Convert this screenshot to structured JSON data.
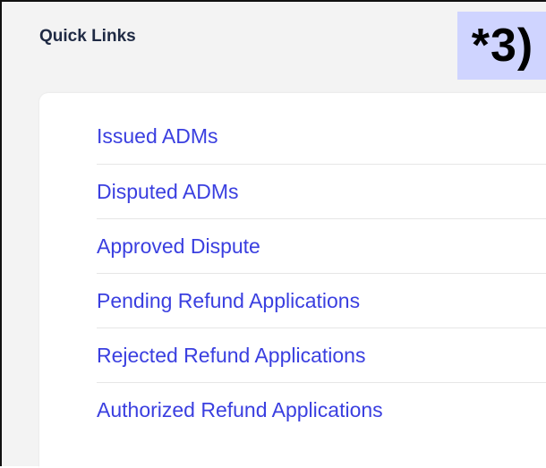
{
  "panel": {
    "title": "Quick Links"
  },
  "annotation": {
    "label": "*3)",
    "background_color": "#cfd4ff"
  },
  "quick_links": {
    "link_color": "#3a3fe0",
    "items": [
      {
        "label": "Issued ADMs"
      },
      {
        "label": "Disputed ADMs"
      },
      {
        "label": "Approved Dispute"
      },
      {
        "label": "Pending Refund Applications"
      },
      {
        "label": "Rejected Refund Applications"
      },
      {
        "label": "Authorized Refund Applications"
      }
    ]
  }
}
